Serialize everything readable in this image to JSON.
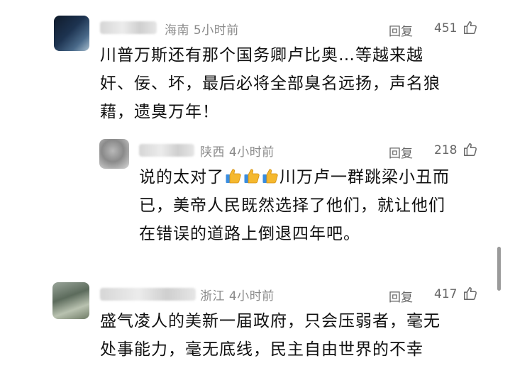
{
  "comments": [
    {
      "location": "海南",
      "time": "5小时前",
      "reply_label": "回复",
      "likes": "451",
      "lines": [
        "川普万斯还有那个国务卿卢比奥…等越来越",
        "奸、佞、坏，最后必将全部臭名远扬，声名狼",
        "藉，遗臭万年！"
      ]
    },
    {
      "location": "陕西",
      "time": "4小时前",
      "reply_label": "回复",
      "likes": "218",
      "text_before_emoji": "说的太对了",
      "emoji": [
        "thumbs-up",
        "thumbs-up",
        "thumbs-up"
      ],
      "text_after_emoji": "川万卢一群跳梁小丑而",
      "lines": [
        "已，美帝人民既然选择了他们，就让他们",
        "在错误的道路上倒退四年吧。"
      ]
    },
    {
      "location": "浙江",
      "time": "4小时前",
      "reply_label": "回复",
      "likes": "417",
      "lines": [
        "盛气凌人的美新一届政府，只会压弱者，毫无",
        "处事能力，毫无底线，民主自由世界的不幸"
      ]
    }
  ],
  "colors": {
    "meta": "#8a8a8a",
    "text": "#111111",
    "emoji": "#f5b82e"
  }
}
